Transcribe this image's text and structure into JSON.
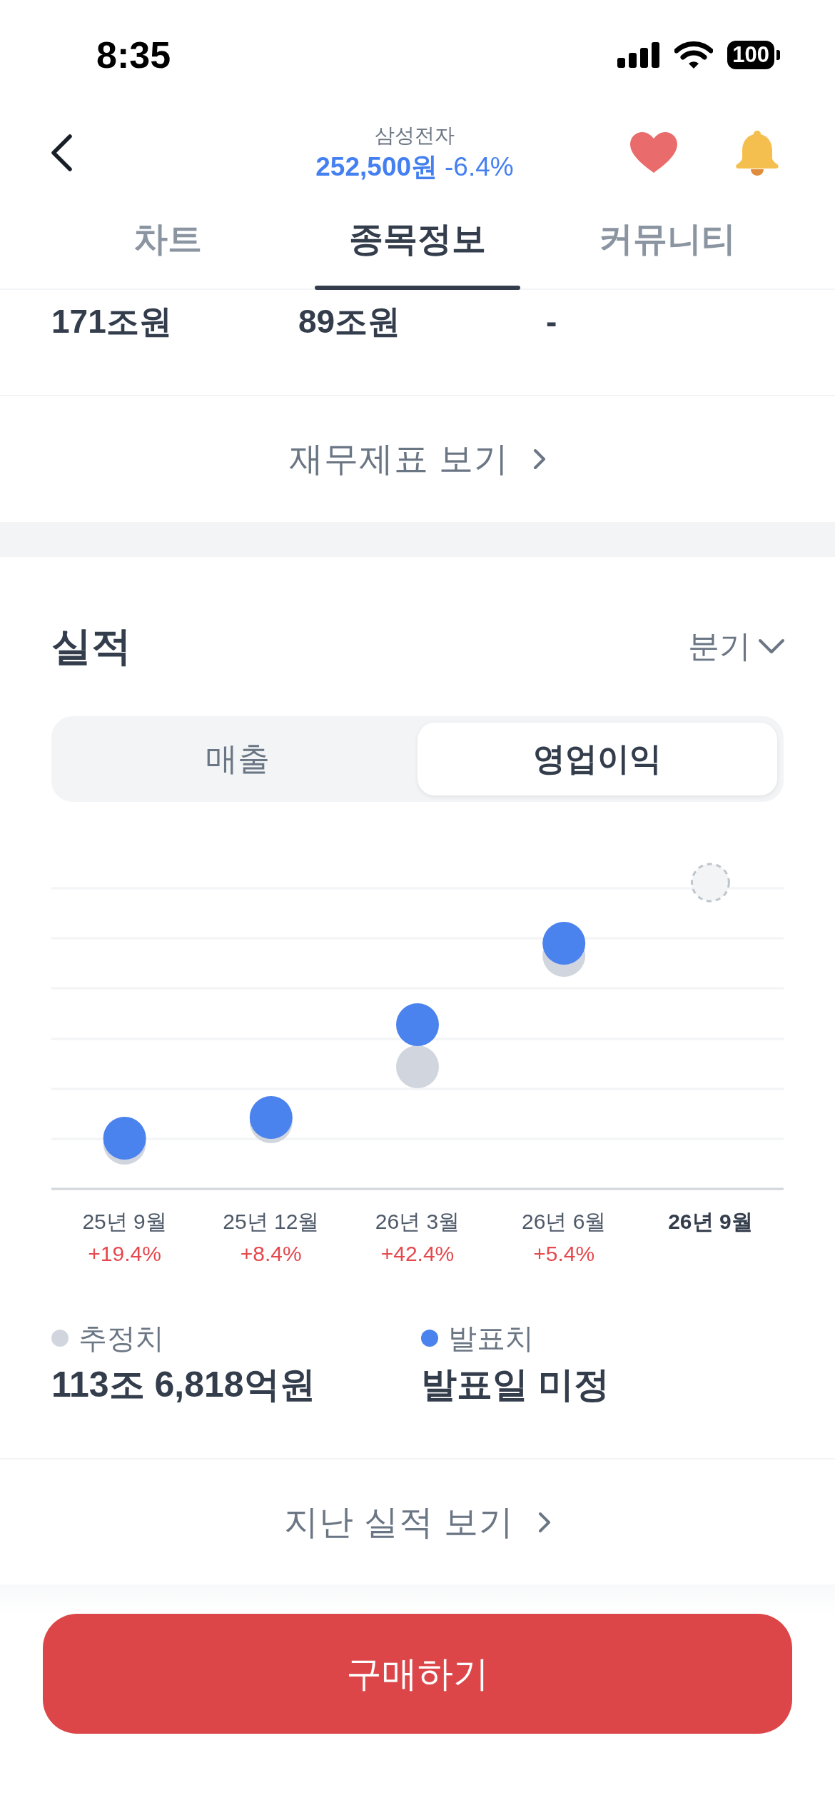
{
  "status_bar": {
    "time": "8:35",
    "battery": "100"
  },
  "header": {
    "title": "삼성전자",
    "price": "252,500원",
    "change": "-6.4%",
    "rising": false,
    "favorite": true
  },
  "tabs": [
    {
      "label": "차트",
      "selected": false
    },
    {
      "label": "종목정보",
      "selected": true
    },
    {
      "label": "커뮤니티",
      "selected": false
    }
  ],
  "financials": {
    "values": [
      "171조원",
      "89조원",
      "-"
    ],
    "link": "재무제표 보기"
  },
  "earnings": {
    "title": "실적",
    "period_select": "분기",
    "segments": [
      {
        "label": "매출",
        "selected": false
      },
      {
        "label": "영업이익",
        "selected": true
      }
    ],
    "periods": [
      {
        "label": "25년 9월",
        "change": "+19.4%",
        "rising": true,
        "announced": true,
        "selected": false
      },
      {
        "label": "25년 12월",
        "change": "+8.4%",
        "rising": true,
        "announced": true,
        "selected": false
      },
      {
        "label": "26년 3월",
        "change": "+42.4%",
        "rising": true,
        "announced": true,
        "selected": false
      },
      {
        "label": "26년 6월",
        "change": "+5.4%",
        "rising": true,
        "announced": true,
        "selected": false
      },
      {
        "label": "26년 9월",
        "announced": false,
        "selected": true
      }
    ],
    "legend": [
      {
        "kind": "estimate",
        "label": "추정치",
        "value": "113조 6,818억원",
        "color": "#d1d6de"
      },
      {
        "kind": "actual",
        "label": "발표치",
        "value": "발표일 미정",
        "color": "#4a82ee"
      }
    ],
    "link": "지난 실적 보기"
  },
  "buy_button": "구매하기"
}
